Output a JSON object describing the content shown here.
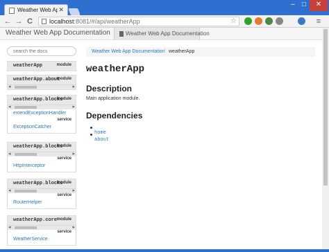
{
  "browser": {
    "tab_title": "Weather Web App Docum",
    "tab_close": "✕",
    "url_host": "localhost",
    "url_rest": ":8081/#/api/weatherApp",
    "window_controls": {
      "minimize": "–",
      "maximize": "□",
      "close": "✕"
    },
    "nav": {
      "back": "←",
      "forward": "→",
      "reload": "C",
      "menu": "≡"
    },
    "extension_colors": [
      "#2aa52a",
      "#e57a2e",
      "#4b8a3c",
      "#888888",
      "#3a78c8"
    ]
  },
  "app": {
    "brand": "Weather Web App Documentation",
    "nav_tab": "Weather Web App Documentation",
    "search_placeholder": "search the docs"
  },
  "sidebar": {
    "modules": [
      {
        "name": "weatherApp",
        "type": "module",
        "services": []
      },
      {
        "name": "weatherApp.about",
        "type": "module",
        "services": []
      },
      {
        "name": "weatherApp.blocks",
        "type": "module",
        "services": [
          {
            "link": "extendExceptionHandler",
            "type": ""
          },
          {
            "link": "ExceptionCatcher",
            "type": "service"
          }
        ]
      },
      {
        "name": "weatherApp.blocks",
        "type": "module",
        "services": [
          {
            "link": "HttpInterceptor",
            "type": "service"
          }
        ]
      },
      {
        "name": "weatherApp.blocks",
        "type": "module",
        "services": [
          {
            "link": "RouterHelper",
            "type": "service"
          }
        ]
      },
      {
        "name": "weatherApp.core",
        "type": "module",
        "services": [
          {
            "link": "WeatherService",
            "type": "service"
          }
        ]
      }
    ]
  },
  "main": {
    "breadcrumb_link": "Weather Web App Documentation",
    "breadcrumb_sep": "/",
    "breadcrumb_current": "weatherApp",
    "title": "weatherApp",
    "description_heading": "Description",
    "description_text": "Main application module.",
    "dependencies_heading": "Dependencies",
    "dependencies": [
      "home",
      "about"
    ]
  }
}
